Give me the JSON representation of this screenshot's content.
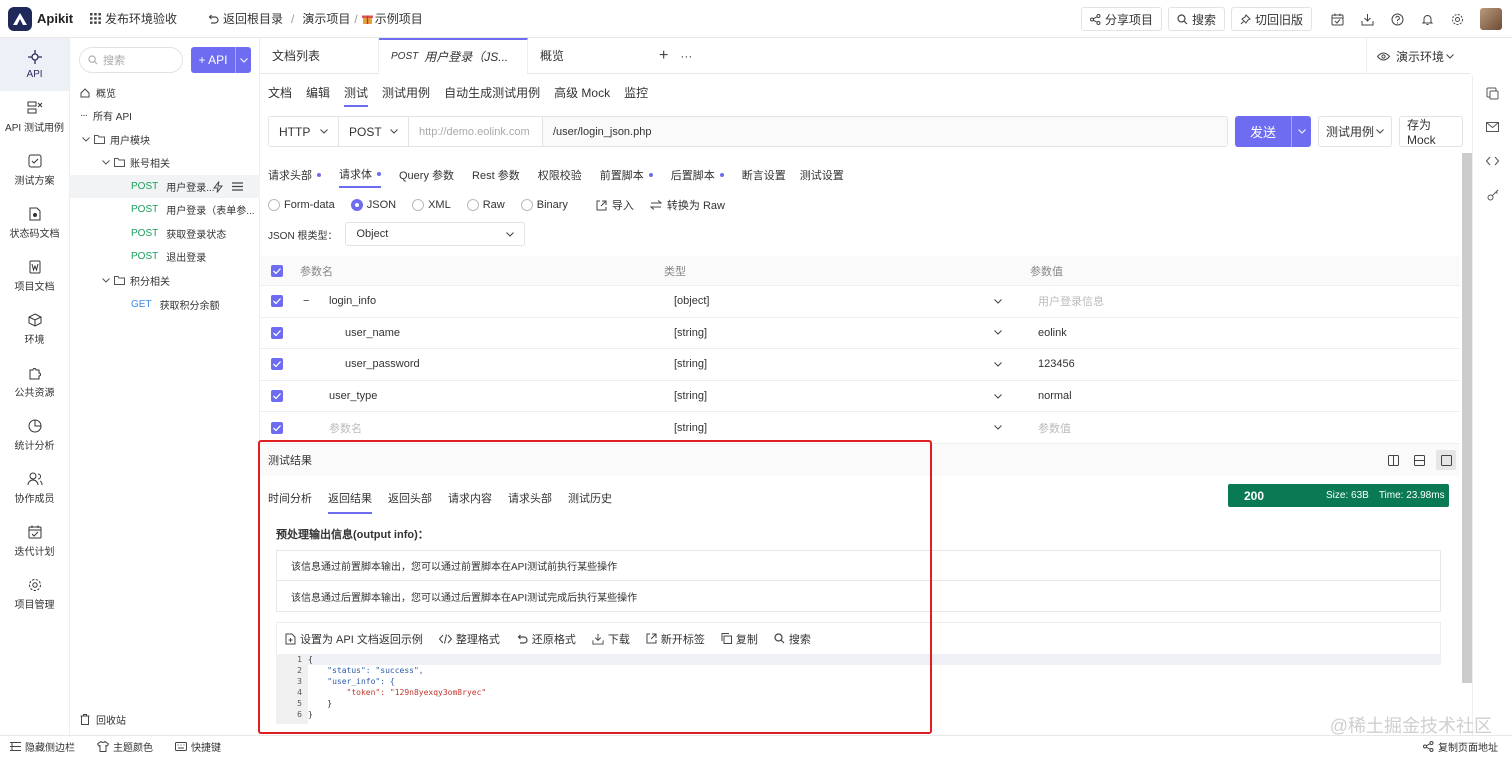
{
  "topbar": {
    "logo_text": "Apikit",
    "workspace": "发布环境验收",
    "back_root": "返回根目录",
    "crumb_project": "演示项目",
    "crumb_current": "示例项目",
    "share": "分享项目",
    "search": "搜索",
    "old_version": "切回旧版"
  },
  "rail": {
    "items": [
      {
        "label": "API"
      },
      {
        "label": "API 测试用例"
      },
      {
        "label": "测试方案"
      },
      {
        "label": "状态码文档"
      },
      {
        "label": "项目文档"
      },
      {
        "label": "环境"
      },
      {
        "label": "公共资源"
      },
      {
        "label": "统计分析"
      },
      {
        "label": "协作成员"
      },
      {
        "label": "迭代计划"
      },
      {
        "label": "项目管理"
      }
    ]
  },
  "tree": {
    "search_placeholder": "搜索",
    "add_api": "+ API",
    "overview": "概览",
    "all_api": "所有 API",
    "group_user": "用户模块",
    "group_account": "账号相关",
    "apis": [
      {
        "method": "POST",
        "name": "用户登录..."
      },
      {
        "method": "POST",
        "name": "用户登录（表单参..."
      },
      {
        "method": "POST",
        "name": "获取登录状态"
      },
      {
        "method": "POST",
        "name": "退出登录"
      }
    ],
    "group_points": "积分相关",
    "points_api": {
      "method": "GET",
      "name": "获取积分余额"
    },
    "recycle": "回收站"
  },
  "tabs": {
    "doc_list": "文档列表",
    "active_method": "POST",
    "active_name": "用户登录（JS...",
    "overview": "概览",
    "plus": "+",
    "more": "···",
    "env": "演示环境"
  },
  "subtabs": [
    "文档",
    "编辑",
    "测试",
    "测试用例",
    "自动生成测试用例",
    "高级 Mock",
    "监控"
  ],
  "request": {
    "protocol": "HTTP",
    "method": "POST",
    "host_placeholder": "http://demo.eolink.com",
    "path": "/user/login_json.php",
    "send": "发送",
    "test_case": "测试用例",
    "save_mock": "存为 Mock"
  },
  "param_tabs": [
    {
      "label": "请求头部",
      "dot": true
    },
    {
      "label": "请求体",
      "dot": true
    },
    {
      "label": "Query 参数",
      "dot": false
    },
    {
      "label": "Rest 参数",
      "dot": false
    },
    {
      "label": "权限校验",
      "dot": false
    },
    {
      "label": "前置脚本",
      "dot": true
    },
    {
      "label": "后置脚本",
      "dot": true
    },
    {
      "label": "断言设置",
      "dot": false
    },
    {
      "label": "测试设置",
      "dot": false
    }
  ],
  "body_types": [
    "Form-data",
    "JSON",
    "XML",
    "Raw",
    "Binary"
  ],
  "import": "导入",
  "to_raw": "转换为 Raw",
  "json_root_label": "JSON 根类型：",
  "json_root_value": "Object",
  "param_table": {
    "headers": [
      "参数名",
      "类型",
      "参数值"
    ],
    "rows": [
      {
        "name": "login_info",
        "type": "[object]",
        "value": "用户登录信息",
        "value_placeholder": true,
        "indent": 0,
        "collapse": "−"
      },
      {
        "name": "user_name",
        "type": "[string]",
        "value": "eolink",
        "value_placeholder": false,
        "indent": 1,
        "collapse": ""
      },
      {
        "name": "user_password",
        "type": "[string]",
        "value": "123456",
        "value_placeholder": false,
        "indent": 1,
        "collapse": ""
      },
      {
        "name": "user_type",
        "type": "[string]",
        "value": "normal",
        "value_placeholder": false,
        "indent": 0,
        "collapse": ""
      },
      {
        "name": "参数名",
        "type": "[string]",
        "value": "参数值",
        "value_placeholder": true,
        "indent": 0,
        "collapse": "",
        "name_placeholder": true
      }
    ]
  },
  "result": {
    "title": "测试结果",
    "tabs": [
      "时间分析",
      "返回结果",
      "返回头部",
      "请求内容",
      "请求头部",
      "测试历史"
    ],
    "status_code": "200",
    "size": "Size: 63B",
    "time": "Time: 23.98ms",
    "output_title": "预处理输出信息(output info)：",
    "output_lines": [
      "该信息通过前置脚本输出，您可以通过前置脚本在API测试前执行某些操作",
      "该信息通过后置脚本输出，您可以通过后置脚本在API测试完成后执行某些操作"
    ],
    "tools": [
      "设置为 API 文档返回示例",
      "整理格式",
      "还原格式",
      "下载",
      "新开标签",
      "复制",
      "搜索"
    ],
    "code_lines": [
      "{",
      "    \"status\": \"success\",",
      "    \"user_info\": {",
      "        \"token\": \"129n8yexqy3om8ryec\"",
      "    }",
      "}"
    ],
    "line_numbers": [
      "1",
      "2",
      "3",
      "4",
      "5",
      "6"
    ]
  },
  "bottombar": {
    "hide_sidebar": "隐藏侧边栏",
    "theme": "主题颜色",
    "shortcuts": "快捷键",
    "copy_url": "复制页面地址"
  },
  "watermark": "@稀土掘金技术社区",
  "colors": {
    "accent": "#6e6cf0",
    "success": "#0a7a55",
    "highlight": "#e02020"
  }
}
